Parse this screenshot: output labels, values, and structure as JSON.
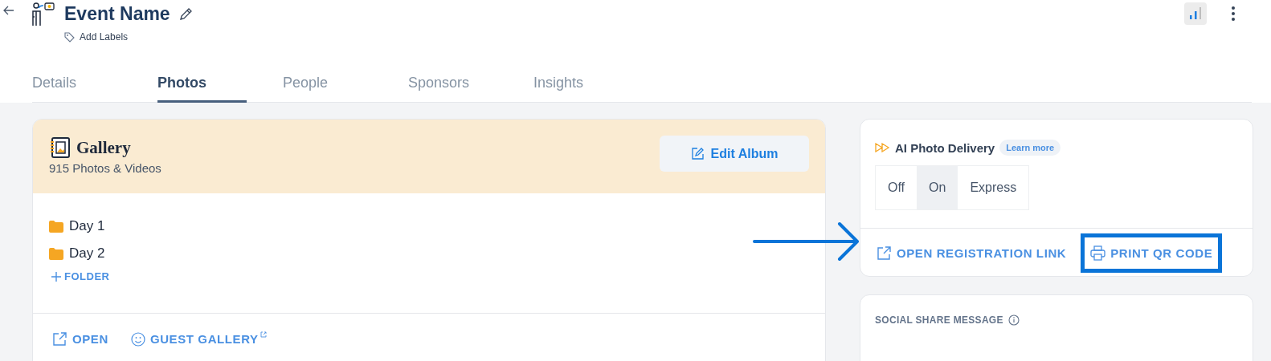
{
  "header": {
    "title": "Event Name",
    "add_labels": "Add Labels"
  },
  "tabs": [
    {
      "label": "Details",
      "selected": false
    },
    {
      "label": "Photos",
      "selected": true
    },
    {
      "label": "People",
      "selected": false
    },
    {
      "label": "Sponsors",
      "selected": false
    },
    {
      "label": "Insights",
      "selected": false
    }
  ],
  "gallery": {
    "title": "Gallery",
    "count": "915 Photos & Videos",
    "edit_button": "Edit Album",
    "folders": [
      {
        "name": "Day 1"
      },
      {
        "name": "Day 2"
      }
    ],
    "add_folder": "FOLDER",
    "links": [
      {
        "label": "OPEN",
        "kind": "external"
      },
      {
        "label": "GUEST GALLERY",
        "kind": "guest"
      }
    ]
  },
  "ai_delivery": {
    "title": "AI Photo Delivery",
    "learn_more": "Learn more",
    "options": [
      {
        "label": "Off",
        "selected": false
      },
      {
        "label": "On",
        "selected": true
      },
      {
        "label": "Express",
        "selected": false
      }
    ],
    "links": [
      {
        "label": "OPEN REGISTRATION LINK",
        "kind": "external",
        "highlighted": false
      },
      {
        "label": "PRINT QR CODE",
        "kind": "print",
        "highlighted": true
      }
    ]
  },
  "social_share": {
    "title": "SOCIAL SHARE MESSAGE"
  }
}
